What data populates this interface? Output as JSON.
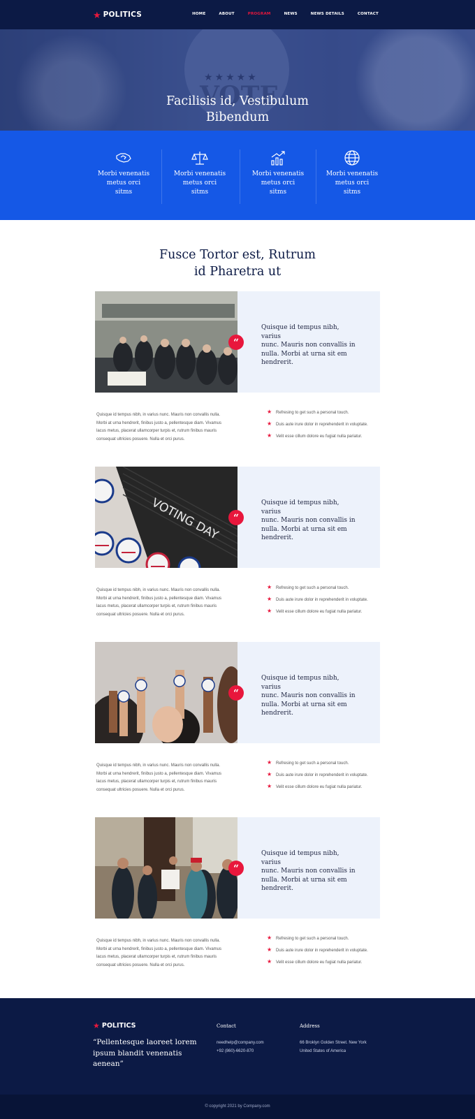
{
  "brand": {
    "name": "POLITICS"
  },
  "nav": [
    "HOME",
    "ABOUT",
    "PROGRAM",
    "NEWS",
    "NEWS DETAILS",
    "CONTACT"
  ],
  "hero": {
    "title_line1": "Facilisis id, Vestibulum",
    "title_line2": "Bibendum",
    "badge_text": "VOTE"
  },
  "features": [
    {
      "icon": "handshake-icon",
      "line1": "Morbi venenatis",
      "line2": "metus orci",
      "line3": "sitms"
    },
    {
      "icon": "scales-icon",
      "line1": "Morbi venenatis",
      "line2": "metus orci",
      "line3": "sitms"
    },
    {
      "icon": "chart-growth-icon",
      "line1": "Morbi venenatis",
      "line2": "metus orci",
      "line3": "sitms"
    },
    {
      "icon": "globe-icon",
      "line1": "Morbi venenatis",
      "line2": "metus orci",
      "line3": "sitms"
    }
  ],
  "section": {
    "title_line1": "Fusce Tortor est, Rutrum",
    "title_line2": "id Pharetra ut"
  },
  "programs": [
    {
      "quote": [
        "Quisque id tempus nibh, varius",
        "nunc. Mauris non convallis in",
        "nulla. Morbi at urna sit em",
        "hendrerit."
      ],
      "para": [
        "Quisque id tempus nibh, in varius nunc. Mauris non convallis nulla.",
        "Morbi at urna hendrerit, finibus justo a, pellentesque diam. Vivamus",
        "lacus metus, placerat ullamcorper turpis et, rutrum finibus mauris",
        "consequat ultricies posuere. Nulla et orci purus."
      ],
      "bullets": [
        "Refresing to get such a personal touch.",
        "Duis aute irure dolor in reprehenderit in voluptate.",
        "Velit esse cillum dolore eu fugiat nulla pariatur."
      ]
    },
    {
      "quote": [
        "Quisque id tempus nibh, varius",
        "nunc. Mauris non convallis in",
        "nulla. Morbi at urna sit em",
        "hendrerit."
      ],
      "para": [
        "Quisque id tempus nibh, in varius nunc. Mauris non convallis nulla.",
        "Morbi at urna hendrerit, finibus justo a, pellentesque diam. Vivamus",
        "lacus metus, placerat ullamcorper turpis et, rutrum finibus mauris",
        "consequat ultricies posuere. Nulla et orci purus."
      ],
      "bullets": [
        "Refresing to get such a personal touch.",
        "Duis aute irure dolor in reprehenderit in voluptate.",
        "Velit esse cillum dolore eu fugiat nulla pariatur."
      ],
      "photo_text": "VOTING DAY"
    },
    {
      "quote": [
        "Quisque id tempus nibh, varius",
        "nunc. Mauris non convallis in",
        "nulla. Morbi at urna sit em",
        "hendrerit."
      ],
      "para": [
        "Quisque id tempus nibh, in varius nunc. Mauris non convallis nulla.",
        "Morbi at urna hendrerit, finibus justo a, pellentesque diam. Vivamus",
        "lacus metus, placerat ullamcorper turpis et, rutrum finibus mauris",
        "consequat ultricies posuere. Nulla et orci purus."
      ],
      "bullets": [
        "Refresing to get such a personal touch.",
        "Duis aute irure dolor in reprehenderit in voluptate.",
        "Velit esse cillum dolore eu fugiat nulla pariatur."
      ]
    },
    {
      "quote": [
        "Quisque id tempus nibh, varius",
        "nunc. Mauris non convallis in",
        "nulla. Morbi at urna sit em",
        "hendrerit."
      ],
      "para": [
        "Quisque id tempus nibh, in varius nunc. Mauris non convallis nulla.",
        "Morbi at urna hendrerit, finibus justo a, pellentesque diam. Vivamus",
        "lacus metus, placerat ullamcorper turpis et, rutrum finibus mauris",
        "consequat ultricies posuere. Nulla et orci purus."
      ],
      "bullets": [
        "Refresing to get such a personal touch.",
        "Duis aute irure dolor in reprehenderit in voluptate.",
        "Velit esse cillum dolore eu fugiat nulla pariatur."
      ]
    }
  ],
  "footer": {
    "tagline": [
      "“Pellentesque laoreet lorem",
      "ipsum blandit venenatis",
      "aenean”"
    ],
    "contact_heading": "Contact",
    "email": "needhelp@company.com",
    "phone": "+92 (860)-6620-870",
    "address_heading": "Address",
    "address1": "66 Broklyn Golden Street. New York",
    "address2": "United States of America",
    "copyright": "© copyright 2021 by Company.com"
  },
  "colors": {
    "navy": "#0c1a45",
    "blue": "#1558e6",
    "red": "#e8173c",
    "panel": "#edf2fb"
  }
}
